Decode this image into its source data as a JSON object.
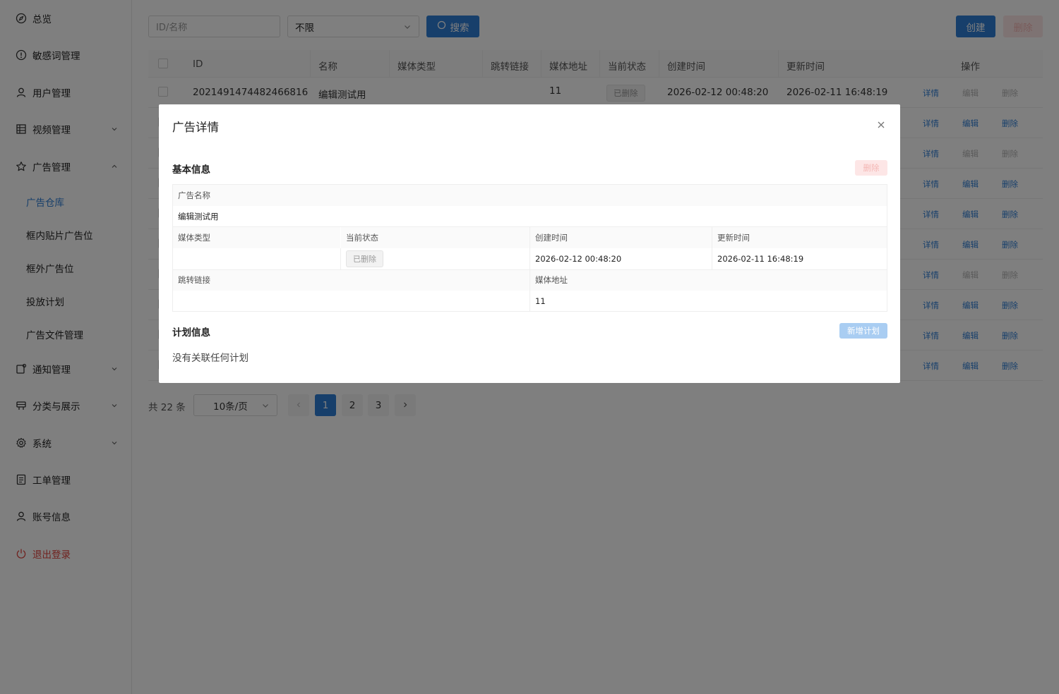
{
  "sidebar": {
    "items": [
      {
        "label": "总览",
        "icon": "compass-icon"
      },
      {
        "label": "敏感词管理",
        "icon": "alert-circle-icon"
      },
      {
        "label": "用户管理",
        "icon": "user-icon"
      },
      {
        "label": "视频管理",
        "icon": "grid-icon"
      },
      {
        "label": "广告管理",
        "icon": "star-icon"
      },
      {
        "label": "通知管理",
        "icon": "notification-icon"
      },
      {
        "label": "分类与展示",
        "icon": "category-icon"
      },
      {
        "label": "系统",
        "icon": "gear-icon"
      },
      {
        "label": "工单管理",
        "icon": "document-icon"
      },
      {
        "label": "账号信息",
        "icon": "user-icon"
      },
      {
        "label": "退出登录",
        "icon": "power-icon"
      }
    ],
    "ad_sub_items": [
      {
        "label": "广告仓库",
        "active": true
      },
      {
        "label": "框内贴片广告位"
      },
      {
        "label": "框外广告位"
      },
      {
        "label": "投放计划"
      },
      {
        "label": "广告文件管理"
      }
    ]
  },
  "toolbar": {
    "search_placeholder": "ID/名称",
    "filter_value": "不限",
    "search_label": "搜索",
    "create_label": "创建",
    "delete_label": "删除"
  },
  "table": {
    "headers": [
      "ID",
      "名称",
      "媒体类型",
      "跳转链接",
      "媒体地址",
      "当前状态",
      "创建时间",
      "更新时间",
      "操作"
    ],
    "first_row": {
      "id": "2021491474482466816",
      "name": "编辑测试用",
      "media_type": "",
      "link": "",
      "media_url": "11",
      "status": "已删除",
      "created": "2026-02-12 00:48:20",
      "updated": "2026-02-11 16:48:19"
    },
    "actions": {
      "detail": "详情",
      "edit": "编辑",
      "delete": "删除"
    },
    "row_action_states": [
      [
        "blue",
        "grey",
        "grey"
      ],
      [
        "blue",
        "blue",
        "blue"
      ],
      [
        "blue",
        "grey",
        "grey"
      ],
      [
        "blue",
        "blue",
        "blue"
      ],
      [
        "blue",
        "blue",
        "blue"
      ],
      [
        "blue",
        "blue",
        "blue"
      ],
      [
        "blue",
        "grey",
        "grey"
      ],
      [
        "blue",
        "blue",
        "blue"
      ],
      [
        "blue",
        "blue",
        "blue"
      ],
      [
        "blue",
        "blue",
        "blue"
      ]
    ]
  },
  "pagination": {
    "total": "共 22 条",
    "page_size": "10条/页",
    "pages": [
      "1",
      "2",
      "3"
    ],
    "current": "1"
  },
  "modal": {
    "title": "广告详情",
    "basic_section": "基本信息",
    "delete_label": "删除",
    "fields": {
      "name_label": "广告名称",
      "name_value": "编辑测试用",
      "media_type_label": "媒体类型",
      "media_type_value": "",
      "status_label": "当前状态",
      "status_value": "已删除",
      "created_label": "创建时间",
      "created_value": "2026-02-12 00:48:20",
      "updated_label": "更新时间",
      "updated_value": "2026-02-11 16:48:19",
      "link_label": "跳转链接",
      "link_value": "",
      "media_url_label": "媒体地址",
      "media_url_value": "11"
    },
    "plan_section": "计划信息",
    "add_plan_label": "新增计划",
    "empty_plan_text": "没有关联任何计划"
  },
  "colors": {
    "primary": "#2f7fd6",
    "danger": "#e0443e",
    "overlay": "rgba(0,0,0,0.5)"
  }
}
